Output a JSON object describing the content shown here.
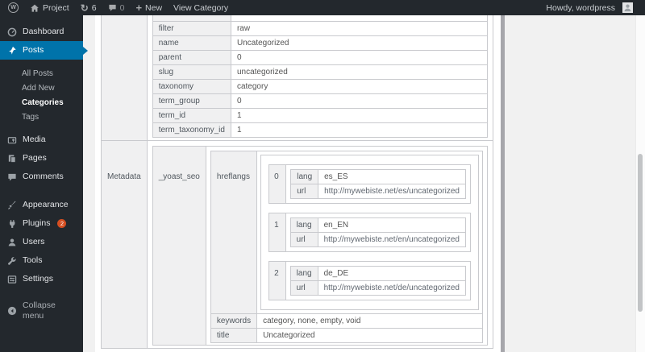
{
  "admin_bar": {
    "site_name": "Project",
    "updates_count": "6",
    "comments_count": "0",
    "new_label": "New",
    "view_link": "View Category",
    "howdy": "Howdy, wordpress"
  },
  "glyphs": {
    "wp_logo": "W",
    "updates": "↻",
    "new_plus": "+"
  },
  "sidebar": {
    "dashboard": "Dashboard",
    "posts": "Posts",
    "posts_submenu": {
      "all_posts": "All Posts",
      "add_new": "Add New",
      "categories": "Categories",
      "tags": "Tags"
    },
    "media": "Media",
    "pages": "Pages",
    "comments": "Comments",
    "appearance": "Appearance",
    "plugins": "Plugins",
    "plugins_badge": "2",
    "users": "Users",
    "tools": "Tools",
    "settings": "Settings",
    "collapse": "Collapse menu"
  },
  "term_fields": {
    "rows": [
      {
        "key": "filter",
        "value": "raw"
      },
      {
        "key": "name",
        "value": "Uncategorized"
      },
      {
        "key": "parent",
        "value": "0"
      },
      {
        "key": "slug",
        "value": "uncategorized"
      },
      {
        "key": "taxonomy",
        "value": "category"
      },
      {
        "key": "term_group",
        "value": "0"
      },
      {
        "key": "term_id",
        "value": "1"
      },
      {
        "key": "term_taxonomy_id",
        "value": "1"
      }
    ]
  },
  "metadata": {
    "section_label": "Metadata",
    "meta_key": "_yoast_seo",
    "hreflangs_label": "hreflangs",
    "hreflangs": [
      {
        "index": "0",
        "lang_label": "lang",
        "lang": "es_ES",
        "url_label": "url",
        "url": "http://mywebiste.net/es/uncategorized"
      },
      {
        "index": "1",
        "lang_label": "lang",
        "lang": "en_EN",
        "url_label": "url",
        "url": "http://mywebiste.net/en/uncategorized"
      },
      {
        "index": "2",
        "lang_label": "lang",
        "lang": "de_DE",
        "url_label": "url",
        "url": "http://mywebiste.net/de/uncategorized"
      }
    ],
    "keywords_label": "keywords",
    "keywords_value": "category, none, empty, void",
    "title_label": "title",
    "title_value": "Uncategorized"
  },
  "colors": {
    "admin_bar_bg": "#23282d",
    "menu_highlight": "#0073aa",
    "plugins_badge_bg": "#d54e21",
    "content_bg": "#f1f1f1",
    "table_border": "#c9cace",
    "label_cell_bg": "#f0f0f1"
  }
}
